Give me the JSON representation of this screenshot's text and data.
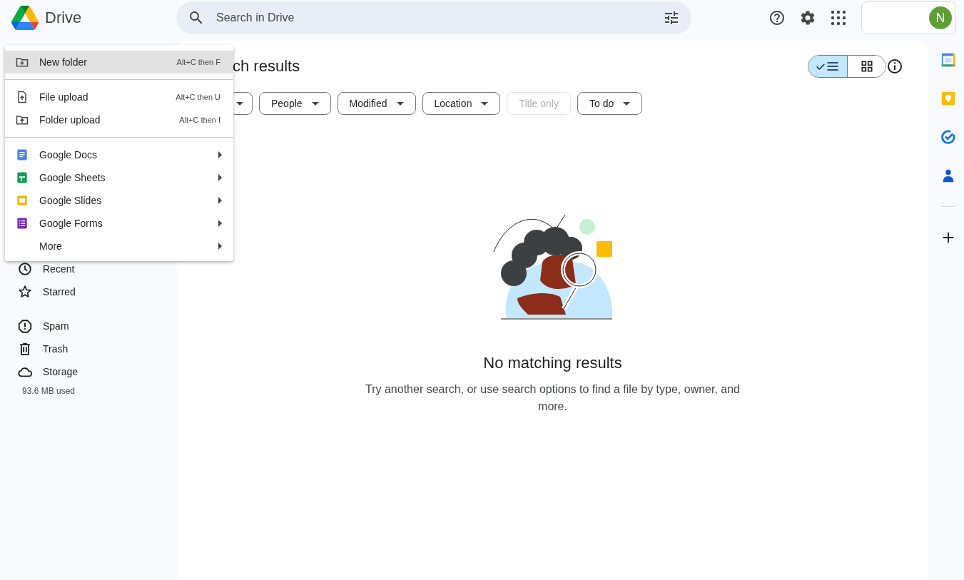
{
  "app": {
    "name": "Drive"
  },
  "search": {
    "placeholder": "Search in Drive"
  },
  "account": {
    "initial": "N"
  },
  "sidebar": {
    "groups": [
      {
        "items": [
          {
            "label": "Recent"
          },
          {
            "label": "Starred"
          }
        ]
      },
      {
        "items": [
          {
            "label": "Spam"
          },
          {
            "label": "Trash"
          },
          {
            "label": "Storage"
          }
        ]
      }
    ],
    "storage_used": "93.6 MB used"
  },
  "main": {
    "heading": "ch results",
    "views": [
      {
        "kind": "list",
        "selected": true
      },
      {
        "kind": "grid",
        "selected": false
      }
    ],
    "filters": [
      {
        "dropdown": true,
        "disabled": false
      },
      {
        "label": "People",
        "dropdown": true,
        "disabled": false
      },
      {
        "label": "Modified",
        "dropdown": true,
        "disabled": false
      },
      {
        "label": "Location",
        "dropdown": true,
        "disabled": false
      },
      {
        "label": "Title only",
        "dropdown": false,
        "disabled": true
      },
      {
        "label": "To do",
        "dropdown": true,
        "disabled": false
      }
    ],
    "empty_state": {
      "title": "No matching results",
      "message": "Try another search, or use search options to find a file by type, owner, and more."
    }
  },
  "menu": {
    "groups": [
      {
        "items": [
          {
            "label": "New folder",
            "shortcut": "Alt+C then F",
            "highlighted": true,
            "submenu": false
          }
        ]
      },
      {
        "items": [
          {
            "label": "File upload",
            "shortcut": "Alt+C then U",
            "highlighted": false,
            "submenu": false
          },
          {
            "label": "Folder upload",
            "shortcut": "Alt+C then I",
            "highlighted": false,
            "submenu": false
          }
        ]
      },
      {
        "items": [
          {
            "label": "Google Docs",
            "highlighted": false,
            "submenu": true
          },
          {
            "label": "Google Sheets",
            "highlighted": false,
            "submenu": true
          },
          {
            "label": "Google Slides",
            "highlighted": false,
            "submenu": true
          },
          {
            "label": "Google Forms",
            "highlighted": false,
            "submenu": true
          },
          {
            "label": "More",
            "highlighted": false,
            "submenu": true
          }
        ]
      }
    ]
  }
}
